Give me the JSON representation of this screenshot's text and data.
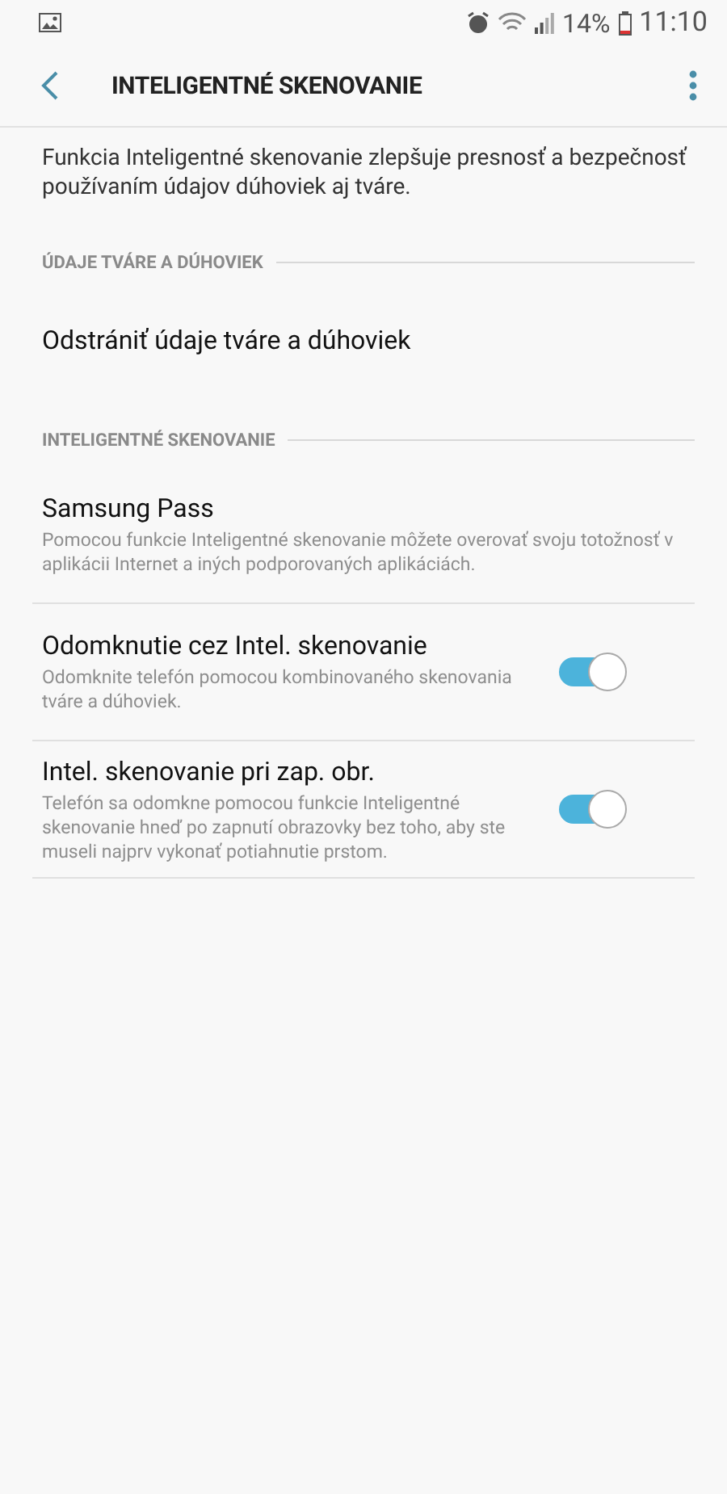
{
  "status_bar": {
    "battery": "14%",
    "time": "11:10"
  },
  "app_bar": {
    "title": "INTELIGENTNÉ SKENOVANIE"
  },
  "intro": "Funkcia Inteligentné skenovanie zlepšuje presnosť a bezpečnosť používaním údajov dúhoviek aj tváre.",
  "sections": [
    {
      "header": "ÚDAJE TVÁRE A DÚHOVIEK",
      "items": [
        {
          "kind": "action",
          "title": "Odstrániť údaje tváre a dúhoviek"
        }
      ]
    },
    {
      "header": "INTELIGENTNÉ SKENOVANIE",
      "items": [
        {
          "kind": "info",
          "title": "Samsung Pass",
          "summary": "Pomocou funkcie Inteligentné skenovanie môžete overovať svoju totožnosť v aplikácii Internet a iných podporovaných aplikáciách."
        },
        {
          "kind": "toggle",
          "title": "Odomknutie cez Intel. skenovanie",
          "summary": "Odomknite telefón pomocou kombinovaného skenovania tváre a dúhoviek.",
          "on": true
        },
        {
          "kind": "toggle",
          "title": "Intel. skenovanie pri zap. obr.",
          "summary": "Telefón sa odomkne pomocou funkcie Inteligentné skenovanie hneď po zapnutí obrazovky bez toho, aby ste museli najprv vykonať potiahnutie prstom.",
          "on": true
        }
      ]
    }
  ]
}
